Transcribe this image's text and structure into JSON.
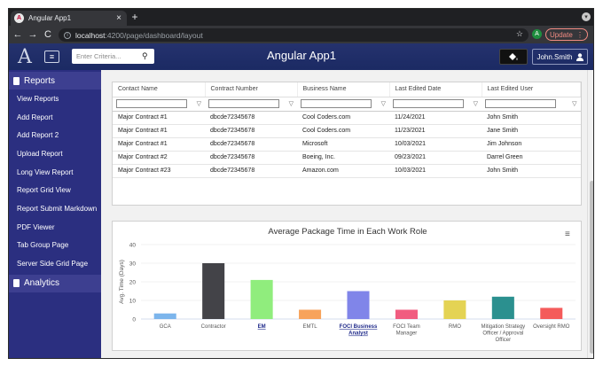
{
  "browser": {
    "tab_title": "Angular App1",
    "tab_close": "×",
    "new_tab": "+",
    "favicon_letter": "A",
    "url_host": "localhost",
    "url_path": ":4200/page/dashboard/layout",
    "profile_initial": "A",
    "update_label": "Update",
    "nav_back": "←",
    "nav_forward": "→",
    "nav_reload": "C"
  },
  "header": {
    "logo": "A",
    "menu_icon": "≡",
    "search_placeholder": "Enter Criteria...",
    "title": "Angular App1",
    "user_name": "John.Smith"
  },
  "sidebar": {
    "reports_label": "Reports",
    "items": [
      {
        "label": "View Reports"
      },
      {
        "label": "Add Report"
      },
      {
        "label": "Add Report 2"
      },
      {
        "label": "Upload Report"
      },
      {
        "label": "Long View Report"
      },
      {
        "label": "Report Grid View"
      },
      {
        "label": "Report Submit Markdown"
      },
      {
        "label": "PDF Viewer"
      },
      {
        "label": "Tab Group Page"
      },
      {
        "label": "Server Side Grid Page"
      }
    ],
    "analytics_label": "Analytics"
  },
  "grid": {
    "columns": [
      "Contact Name",
      "Contract Number",
      "Business Name",
      "Last Edited Date",
      "Last Edited User"
    ],
    "rows": [
      [
        "Major Contract #1",
        "dbcde72345678",
        "Cool Coders.com",
        "11/24/2021",
        "John Smith"
      ],
      [
        "Major Contract #1",
        "dbcde72345678",
        "Cool Coders.com",
        "11/23/2021",
        "Jane Smith"
      ],
      [
        "Major Contract #1",
        "dbcde72345678",
        "Microsoft",
        "10/03/2021",
        "Jim Johnson"
      ],
      [
        "Major Contract #2",
        "dbcde72345678",
        "Boeing, Inc.",
        "09/23/2021",
        "Darrel Green"
      ],
      [
        "Major Contract #23",
        "dbcde72345678",
        "Amazon.com",
        "10/03/2021",
        "John Smith"
      ]
    ]
  },
  "chart_data": {
    "type": "bar",
    "title": "Average Package Time in Each Work Role",
    "ylabel": "Avg. Time (Days)",
    "xlabel": "",
    "ylim": [
      0,
      40
    ],
    "yticks": [
      0,
      10,
      20,
      30,
      40
    ],
    "categories": [
      "GCA",
      "Contractor",
      "EM",
      "EMTL",
      "FOCI Business Analyst",
      "FOCI Team Manager",
      "RMO",
      "Mitigation Strategy Officer / Approval Officer",
      "Oversight RMO"
    ],
    "category_lines": [
      [
        "GCA"
      ],
      [
        "Contractor"
      ],
      [
        "EM"
      ],
      [
        "EMTL"
      ],
      [
        "FOCI Business",
        "Analyst"
      ],
      [
        "FOCI Team",
        "Manager"
      ],
      [
        "RMO"
      ],
      [
        "Mitigation Strategy",
        "Officer / Approval",
        "Officer"
      ],
      [
        "Oversight RMO"
      ]
    ],
    "highlighted": [
      "EM",
      "FOCI Business Analyst"
    ],
    "values": [
      3,
      30,
      21,
      5,
      15,
      5,
      10,
      12,
      6
    ],
    "colors": [
      "#7cb5ec",
      "#434348",
      "#90ed7d",
      "#f7a35c",
      "#8085e9",
      "#f15c80",
      "#e4d354",
      "#2b908f",
      "#f45b5b"
    ],
    "legend": "none",
    "grid": true
  },
  "colors": {
    "sidebar_bg": "#2b2f80",
    "header_bg": "#1b2a63",
    "highlight_link": "#1f2a8a"
  }
}
